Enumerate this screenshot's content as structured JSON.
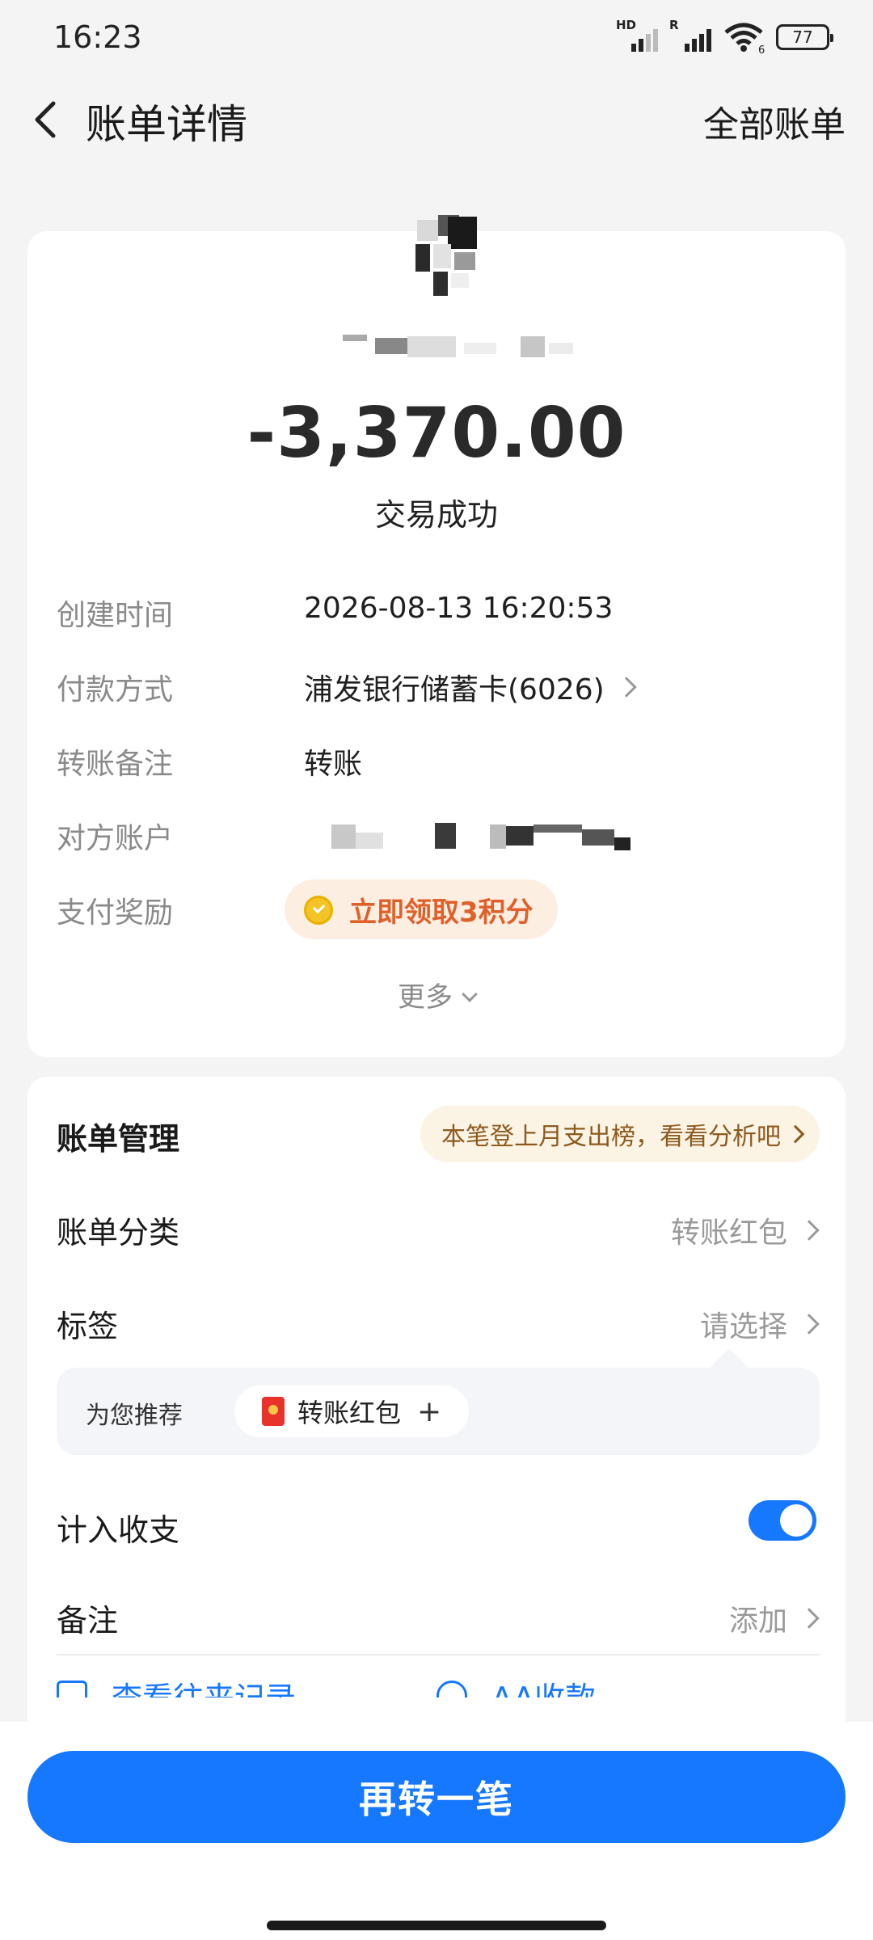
{
  "status_bar": {
    "time": "16:23",
    "signal1_label": "HD",
    "signal2_label": "R",
    "wifi_sub": "6",
    "battery": "77"
  },
  "header": {
    "title": "账单详情",
    "right_link": "全部账单"
  },
  "summary": {
    "amount": "-3,370.00",
    "status": "交易成功"
  },
  "details": {
    "created_label": "创建时间",
    "created_value": "2026-08-13 16:20:53",
    "payment_label": "付款方式",
    "payment_value": "浦发银行储蓄卡(6026)",
    "memo_label": "转账备注",
    "memo_value": "转账",
    "counterparty_label": "对方账户",
    "reward_label": "支付奖励",
    "reward_value": "立即领取3积分",
    "more": "更多"
  },
  "manage": {
    "title": "账单管理",
    "analysis_hint": "本笔登上月支出榜，看看分析吧",
    "category_label": "账单分类",
    "category_value": "转账红包",
    "tag_label": "标签",
    "tag_value": "请选择",
    "recommend_label": "为您推荐",
    "recommend_chip": "转账红包",
    "recommend_plus": "+",
    "include_label": "计入收支",
    "include_on": true,
    "note_label": "备注",
    "note_value": "添加",
    "link_history": "查看往来记录",
    "link_aa": "AA收款"
  },
  "cta": {
    "label": "再转一笔"
  },
  "colors": {
    "accent": "#1677ff",
    "reward_text": "#e0602a",
    "reward_bg": "#fdeee2"
  }
}
